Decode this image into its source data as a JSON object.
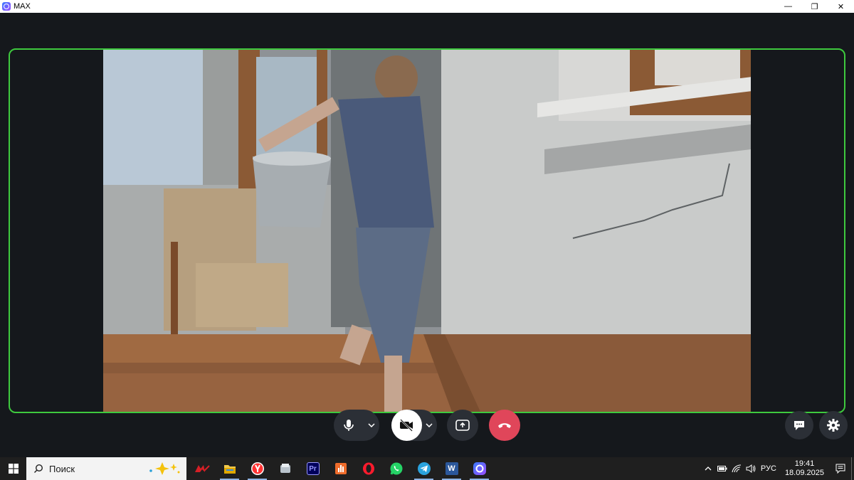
{
  "window": {
    "title": "MAX",
    "minimize_glyph": "—",
    "maximize_glyph": "❐",
    "close_glyph": "✕"
  },
  "call": {
    "active_border_color": "#3ec93e",
    "video_description_icon": "remote-video-feed"
  },
  "controls": {
    "mic_icon": "microphone-icon",
    "camera_icon": "camera-off-icon",
    "share_icon": "screen-share-icon",
    "hangup_icon": "hang-up-icon",
    "hangup_color": "#e0465a",
    "chat_icon": "chat-icon",
    "settings_icon": "settings-gear-icon"
  },
  "taskbar": {
    "search_placeholder": "Поиск",
    "apps": [
      {
        "name": "app-red-logo",
        "active": false
      },
      {
        "name": "file-explorer",
        "active": true
      },
      {
        "name": "yandex-browser",
        "active": true
      },
      {
        "name": "app-grey",
        "active": false
      },
      {
        "name": "premiere-pro",
        "active": false,
        "label": "Pr"
      },
      {
        "name": "app-orange",
        "active": false
      },
      {
        "name": "opera",
        "active": false
      },
      {
        "name": "whatsapp",
        "active": false
      },
      {
        "name": "telegram",
        "active": true
      },
      {
        "name": "word",
        "active": true,
        "label": "W"
      },
      {
        "name": "max",
        "active": true
      }
    ],
    "language": "РУС",
    "time": "19:41",
    "date": "18.09.2025"
  }
}
